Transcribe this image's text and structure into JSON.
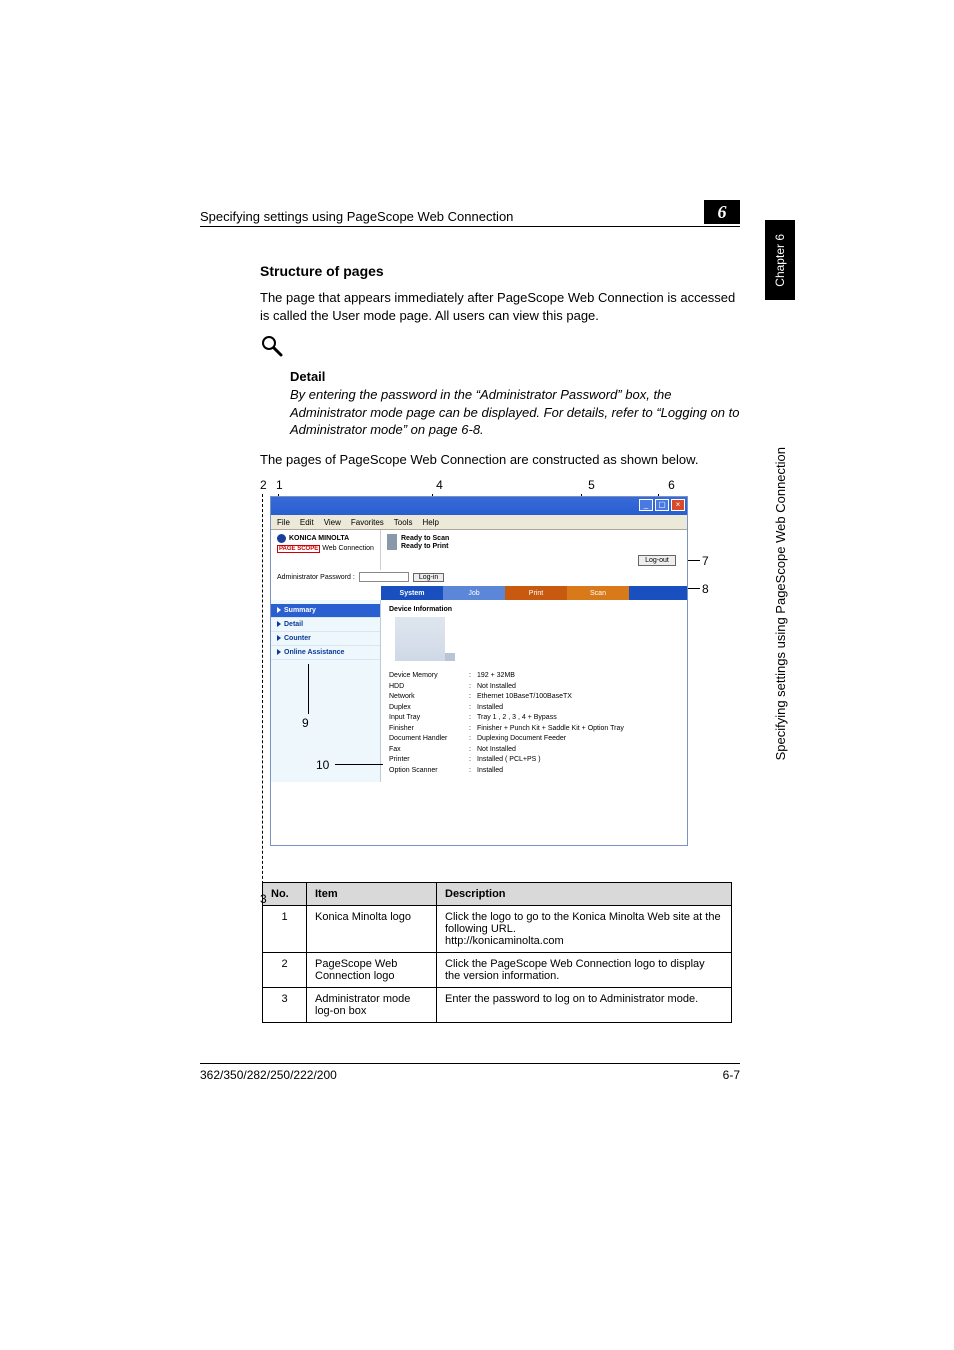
{
  "header": {
    "title": "Specifying settings using PageScope Web Connection",
    "chapnum": "6"
  },
  "side": {
    "tab": "Chapter 6",
    "label": "Specifying settings using PageScope Web Connection"
  },
  "section_heading": "Structure of pages",
  "paragraph_1": "The page that appears immediately after PageScope Web Connection is accessed is called the User mode page. All users can view this page.",
  "detail": {
    "heading": "Detail",
    "body": "By entering the password in the “Administrator Password” box, the Administrator mode page can be displayed. For details, refer to “Logging on to Administrator mode” on page 6-8."
  },
  "paragraph_2": "The pages of PageScope Web Connection are constructed as shown below.",
  "callouts": {
    "c1": "1",
    "c2": "2",
    "c3": "3",
    "c4": "4",
    "c5": "5",
    "c6": "6",
    "c7": "7",
    "c8": "8",
    "c9": "9",
    "c10": "10"
  },
  "ie": {
    "menu": {
      "file": "File",
      "edit": "Edit",
      "view": "View",
      "favorites": "Favorites",
      "tools": "Tools",
      "help": "Help"
    }
  },
  "screenshot": {
    "km_logo": "KONICA MINOLTA",
    "ps": "PAGE SCOPE",
    "wc": "Web Connection",
    "ready_scan": "Ready to Scan",
    "ready_print": "Ready to Print",
    "logout": "Log-out",
    "admin_pw_label": "Administrator Password :",
    "login": "Log-in",
    "tabs": {
      "system": "System",
      "job": "Job",
      "print": "Print",
      "scan": "Scan"
    },
    "sidebar": {
      "summary": "Summary",
      "detail": "Detail",
      "counter": "Counter",
      "online": "Online Assistance"
    },
    "dev_heading": "Device Information",
    "rows": {
      "mem_k": "Device Memory",
      "mem_v": "192 + 32MB",
      "hdd_k": "HDD",
      "hdd_v": "Not Installed",
      "net_k": "Network",
      "net_v": "Ethernet 10BaseT/100BaseTX",
      "dup_k": "Duplex",
      "dup_v": "Installed",
      "tray_k": "Input Tray",
      "tray_v": "Tray 1 , 2 , 3 , 4 + Bypass",
      "fin_k": "Finisher",
      "fin_v": "Finisher + Punch Kit + Saddle Kit + Option Tray",
      "doc_k": "Document Handler",
      "doc_v": "Duplexing Document Feeder",
      "fax_k": "Fax",
      "fax_v": "Not Installed",
      "prn_k": "Printer",
      "prn_v": "Installed ( PCL+PS )",
      "opt_k": "Option Scanner",
      "opt_v": "Installed"
    }
  },
  "table": {
    "head": {
      "no": "No.",
      "item": "Item",
      "desc": "Description"
    },
    "r1": {
      "no": "1",
      "item": "Konica Minolta logo",
      "desc": "Click the logo to go to the Konica Minolta Web site at the following URL.\nhttp://konicaminolta.com"
    },
    "r2": {
      "no": "2",
      "item": "PageScope Web Connection logo",
      "desc": "Click the PageScope Web Connection logo to display the version information."
    },
    "r3": {
      "no": "3",
      "item": "Administrator mode log-on box",
      "desc": "Enter the password to log on to Administrator mode."
    }
  },
  "footer": {
    "model": "362/350/282/250/222/200",
    "page": "6-7"
  }
}
